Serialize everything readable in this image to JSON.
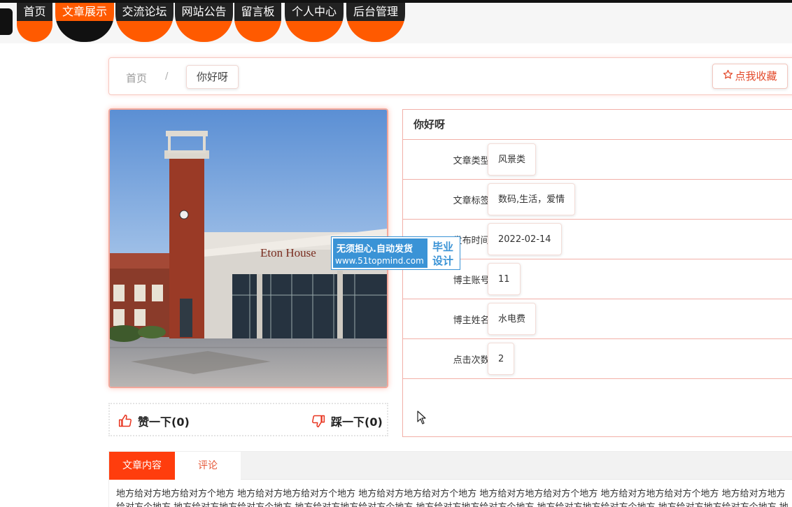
{
  "nav": {
    "items": [
      {
        "label": "首页"
      },
      {
        "label": "文章展示"
      },
      {
        "label": "交流论坛"
      },
      {
        "label": "网站公告"
      },
      {
        "label": "留言板"
      },
      {
        "label": "个人中心"
      },
      {
        "label": "后台管理"
      }
    ],
    "active": "文章展示"
  },
  "breadcrumb": {
    "home": "首页",
    "separator": "/",
    "current": "你好呀"
  },
  "favorite_button": {
    "label": "点我收藏",
    "icon": "star-icon"
  },
  "article": {
    "title": "你好呀",
    "fields": [
      {
        "label": "文章类型:",
        "value": "风景类"
      },
      {
        "label": "文章标签:",
        "value": "数码,生活，爱情"
      },
      {
        "label": "发布时间:",
        "value": "2022-02-14"
      },
      {
        "label": "博主账号:",
        "value": "11"
      },
      {
        "label": "博主姓名:",
        "value": "水电费"
      },
      {
        "label": "点击次数:",
        "value": "2"
      }
    ],
    "image_text": "Eton House"
  },
  "reactions": {
    "like_label": "赞一下(0)",
    "dislike_label": "踩一下(0)"
  },
  "watermark": {
    "line1": "无须担心.自动发货",
    "line2": "www.51topmind.com",
    "side_line1": "毕业",
    "side_line2": "设计"
  },
  "tabs": {
    "items": [
      {
        "label": "文章内容"
      },
      {
        "label": "评论"
      }
    ],
    "content": "地方给对方地方给对方个地方 地方给对方地方给对方个地方 地方给对方地方给对方个地方 地方给对方地方给对方个地方 地方给对方地方给对方个地方 地方给对方地方给对方个地方 地方给对方地方给对方个地方 地方给对方地方给对方个地方 地方给对方地方给对方个地方 地方给对方地方给对方个地方 地方给对方地方给对方个地方 地方给对方"
  },
  "colors": {
    "accent": "#ff5a00",
    "nav_dark": "#222222",
    "border_pink": "#f2b0a8",
    "tab_active": "#ff3d0d",
    "watermark_blue": "#3a93d6"
  }
}
